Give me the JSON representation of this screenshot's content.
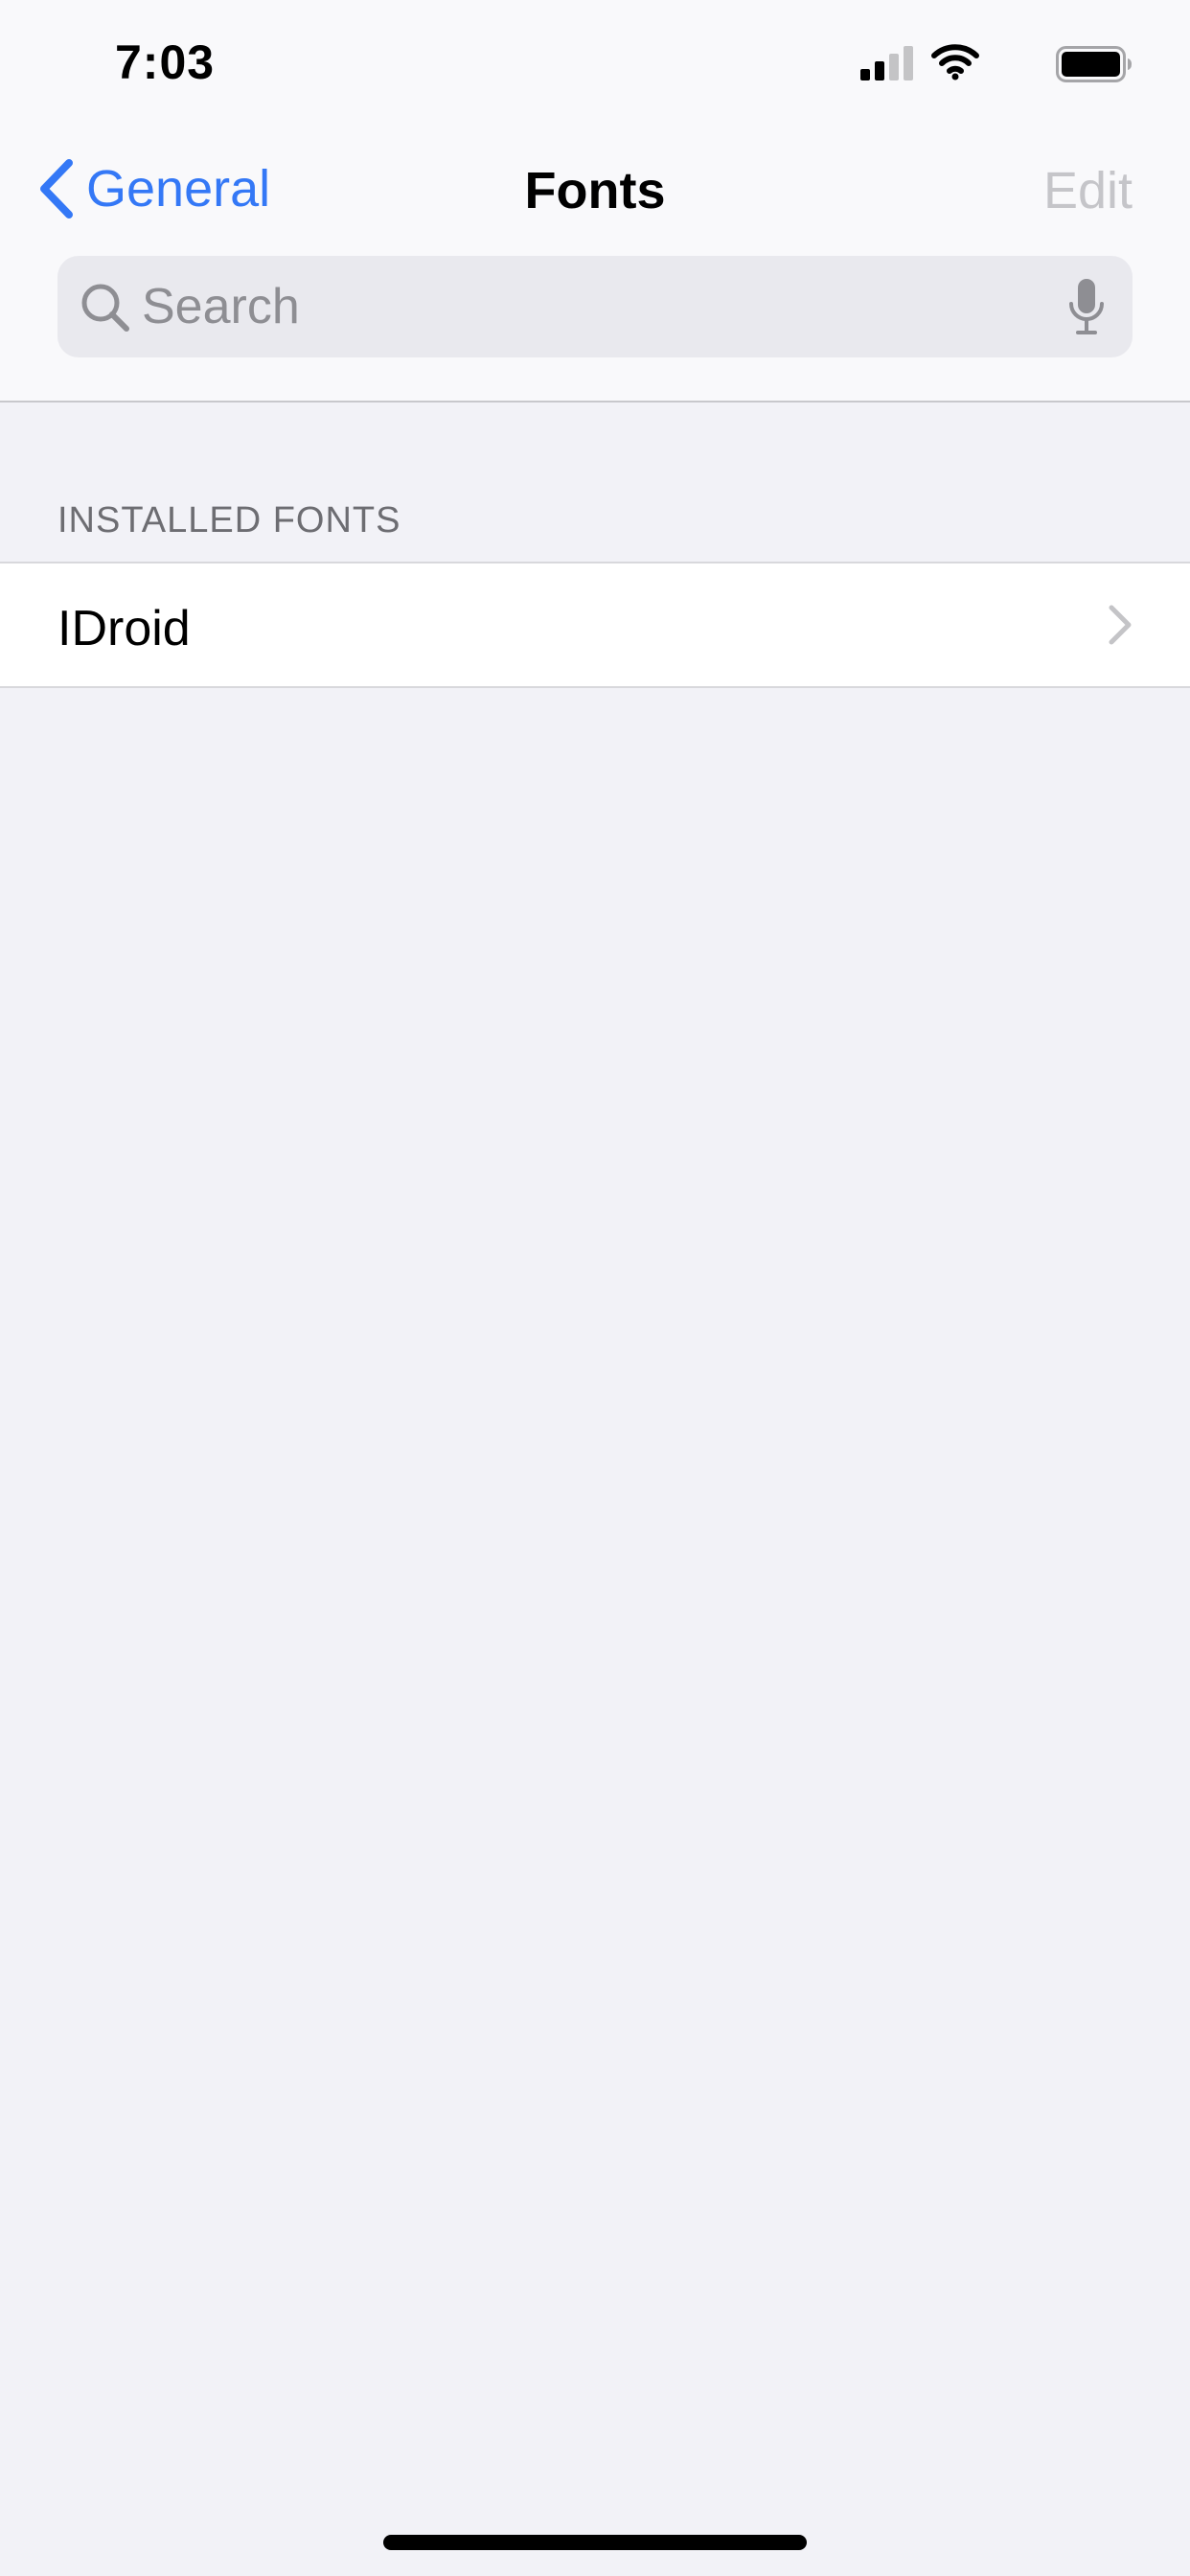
{
  "status_bar": {
    "time": "7:03",
    "icons": [
      "cellular-signal-icon",
      "wifi-icon",
      "battery-icon"
    ]
  },
  "nav": {
    "back_label": "General",
    "title": "Fonts",
    "edit_label": "Edit"
  },
  "search": {
    "placeholder": "Search",
    "value": ""
  },
  "sections": [
    {
      "header": "INSTALLED FONTS",
      "items": [
        {
          "label": "IDroid"
        }
      ]
    }
  ],
  "colors": {
    "accent": "#3478f6",
    "background": "#f2f2f7",
    "chrome": "#f9f9fb",
    "disabled": "#c5c5c9",
    "secondary_text": "#6d6d72"
  }
}
